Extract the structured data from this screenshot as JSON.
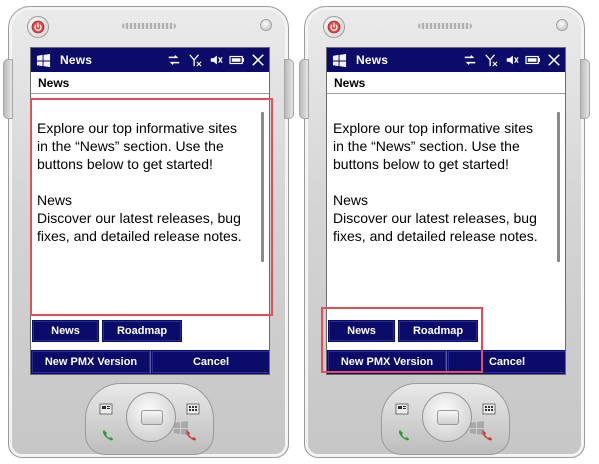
{
  "devices": [
    {
      "status_title": "News",
      "app_header": "News",
      "content": {
        "intro": "Explore our top informative sites in the “News” section. Use the buttons below to get started!",
        "section_title": "News",
        "section_body": "Discover our latest releases, bug fixes, and detailed release notes."
      },
      "buttons": {
        "news": "News",
        "roadmap": "Roadmap",
        "new_pmx_version": "New PMX Version",
        "cancel": "Cancel"
      }
    },
    {
      "status_title": "News",
      "app_header": "News",
      "content": {
        "intro": "Explore our top informative sites in the “News” section. Use the buttons below to get started!",
        "section_title": "News",
        "section_body": "Discover our latest releases, bug fixes, and detailed release notes."
      },
      "buttons": {
        "news": "News",
        "roadmap": "Roadmap",
        "new_pmx_version": "New PMX Version",
        "cancel": "Cancel"
      }
    }
  ],
  "icons": {
    "start": "windows-start-icon",
    "connectivity": "connectivity-icon",
    "signal": "no-signal-icon",
    "volume": "volume-mute-icon",
    "battery": "battery-icon",
    "close": "close-icon",
    "power": "power-icon"
  },
  "colors": {
    "title_bar": "#0b0b6a",
    "button_bg": "#0b0b6a",
    "highlight": "#e0505a",
    "device_body": "#d4d4d4"
  }
}
